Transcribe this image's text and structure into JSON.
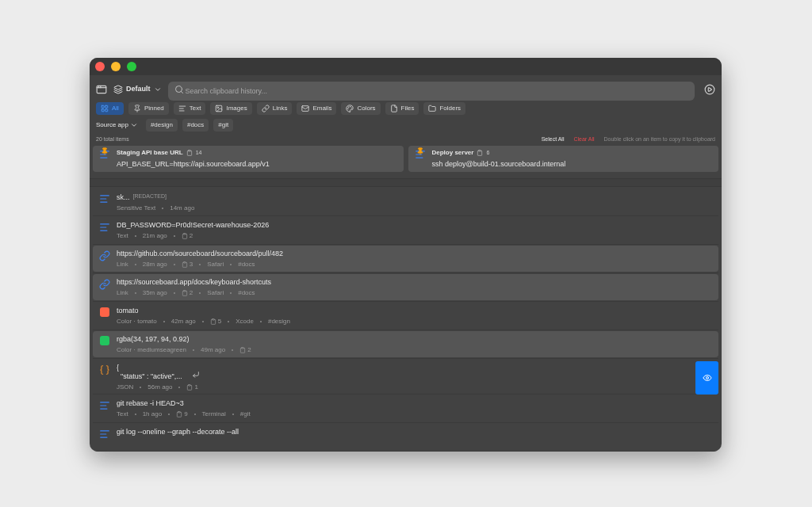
{
  "toolbar": {
    "profile": "Default",
    "search": {
      "placeholder": "Search clipboard history..."
    }
  },
  "filters": [
    {
      "kind": "all",
      "label": "All",
      "selected": true
    },
    {
      "kind": "pin",
      "label": "Pinned",
      "selected": false
    },
    {
      "kind": "text",
      "label": "Text",
      "selected": false
    },
    {
      "kind": "image",
      "label": "Images",
      "selected": false
    },
    {
      "kind": "link",
      "label": "Links",
      "selected": false
    },
    {
      "kind": "mail",
      "label": "Emails",
      "selected": false
    },
    {
      "kind": "color",
      "label": "Colors",
      "selected": false
    },
    {
      "kind": "file",
      "label": "Files",
      "selected": false
    },
    {
      "kind": "folder",
      "label": "Folders",
      "selected": false
    }
  ],
  "source_app": "Source app",
  "tags": [
    "#design",
    "#docs",
    "#git"
  ],
  "summary": {
    "count": "20 total items",
    "select_all": "Select All",
    "clear_all": "Clear All",
    "hint": "Double click on an item to copy it to clipboard"
  },
  "pinned": [
    {
      "title": "Staging API base URL",
      "copies": "14",
      "value": "API_BASE_URL=https://api.sourceboard.app/v1"
    },
    {
      "title": "Deploy server",
      "copies": "6",
      "value": "ssh deploy@build-01.sourceboard.internal"
    }
  ],
  "items": [
    {
      "kind": "text",
      "lines": [
        "sk..."
      ],
      "redacted": "[REDACTED]",
      "meta": [
        {
          "kind": "text",
          "text": "Sensitive Text"
        },
        {
          "kind": "text",
          "text": "14m ago"
        }
      ],
      "selected": false,
      "preview_button": false
    },
    {
      "kind": "text",
      "lines": [
        "DB_PASSWORD=Pr0d!Secret-warehouse-2026"
      ],
      "meta": [
        {
          "kind": "text",
          "text": "Text"
        },
        {
          "kind": "text",
          "text": "21m ago"
        },
        {
          "kind": "count",
          "text": "2"
        }
      ],
      "selected": false,
      "preview_button": false
    },
    {
      "kind": "link",
      "lines": [
        "https://github.com/sourceboard/sourceboard/pull/482"
      ],
      "meta": [
        {
          "kind": "text",
          "text": "Link"
        },
        {
          "kind": "text",
          "text": "28m ago"
        },
        {
          "kind": "count",
          "text": "3"
        },
        {
          "kind": "text",
          "text": "Safari"
        },
        {
          "kind": "text",
          "text": "#docs"
        }
      ],
      "selected": true,
      "preview_button": false
    },
    {
      "kind": "link",
      "lines": [
        "https://sourceboard.app/docs/keyboard-shortcuts"
      ],
      "meta": [
        {
          "kind": "text",
          "text": "Link"
        },
        {
          "kind": "text",
          "text": "35m ago"
        },
        {
          "kind": "count",
          "text": "2"
        },
        {
          "kind": "text",
          "text": "Safari"
        },
        {
          "kind": "text",
          "text": "#docs"
        }
      ],
      "selected": true,
      "preview_button": false
    },
    {
      "kind": "color",
      "color": "#ff6347",
      "lines": [
        "tomato"
      ],
      "meta": [
        {
          "kind": "text",
          "text": "Color · tomato"
        },
        {
          "kind": "text",
          "text": "42m ago"
        },
        {
          "kind": "count",
          "text": "5"
        },
        {
          "kind": "text",
          "text": "Xcode"
        },
        {
          "kind": "text",
          "text": "#design"
        }
      ],
      "selected": false,
      "preview_button": false
    },
    {
      "kind": "color",
      "color": "#22c55e",
      "lines": [
        "rgba(34, 197, 94, 0.92)"
      ],
      "meta": [
        {
          "kind": "text",
          "text": "Color · mediumseagreen"
        },
        {
          "kind": "text",
          "text": "49m ago"
        },
        {
          "kind": "count",
          "text": "2"
        }
      ],
      "selected": true,
      "preview_button": false
    },
    {
      "kind": "json",
      "lines": [
        "{",
        "  \"status\" : \"active\",..."
      ],
      "meta": [
        {
          "kind": "text",
          "text": "JSON"
        },
        {
          "kind": "text",
          "text": "56m ago"
        },
        {
          "kind": "count",
          "text": "1"
        }
      ],
      "selected": false,
      "preview_button": true
    },
    {
      "kind": "text",
      "lines": [
        "git rebase -i HEAD~3"
      ],
      "meta": [
        {
          "kind": "text",
          "text": "Text"
        },
        {
          "kind": "text",
          "text": "1h ago"
        },
        {
          "kind": "count",
          "text": "9"
        },
        {
          "kind": "text",
          "text": "Terminal"
        },
        {
          "kind": "text",
          "text": "#git"
        }
      ],
      "selected": false,
      "preview_button": false
    },
    {
      "kind": "text",
      "lines": [
        "git log --oneline --graph --decorate --all"
      ],
      "selected": false,
      "preview_button": false
    }
  ]
}
